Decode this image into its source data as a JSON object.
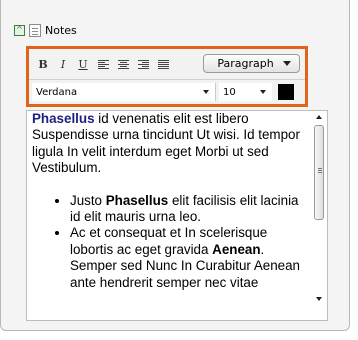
{
  "header": {
    "title": "Notes",
    "toggle_icon": "collapse-toggle-icon",
    "doc_icon": "document-icon"
  },
  "toolbar": {
    "bold_label": "B",
    "italic_label": "I",
    "underline_label": "U",
    "align_icons": [
      "align-left-icon",
      "align-center-icon",
      "align-right-icon",
      "align-justify-icon"
    ],
    "paragraph_value": "Paragraph",
    "font_value": "Verdana",
    "size_value": "10",
    "text_color": "#000000",
    "highlight_color": "#e0641c"
  },
  "editor": {
    "paragraph": {
      "kw1": "Phasellus",
      "text1": " id venenatis elit est libero Suspendisse urna tincidunt Ut wisi. Id tempor ligula In velit interdum eget Morbi ut sed Vestibulum."
    },
    "list": [
      {
        "pre": "Justo ",
        "bold": "Phasellus",
        "post": " elit facilisis elit lacinia id elit mauris urna leo."
      },
      {
        "pre": "Ac et consequat et In scelerisque lobortis ac eget gravida ",
        "bold": "Aenean",
        "post": ". Semper sed Nunc In Curabitur Aenean ante hendrerit semper nec vitae"
      }
    ]
  }
}
